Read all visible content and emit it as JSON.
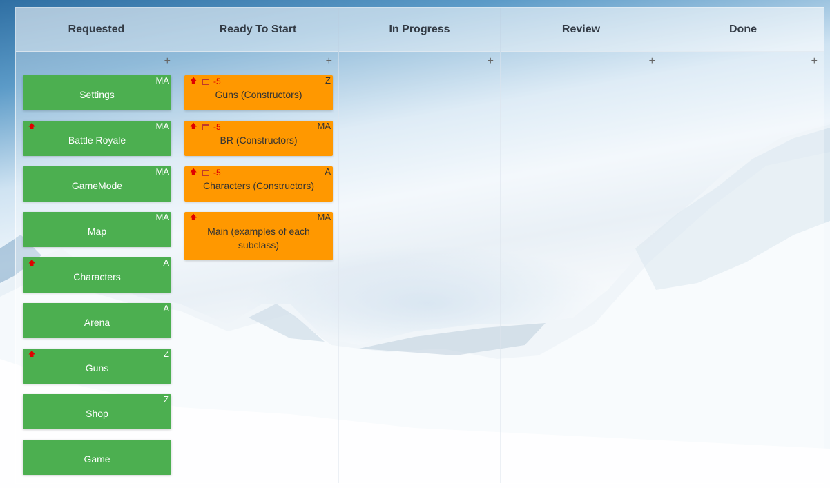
{
  "columns": [
    {
      "title": "Requested",
      "add_label": "+",
      "cards": [
        {
          "title": "Settings",
          "assignee": "MA",
          "priority": false
        },
        {
          "title": "Battle Royale",
          "assignee": "MA",
          "priority": true
        },
        {
          "title": "GameMode",
          "assignee": "MA",
          "priority": false
        },
        {
          "title": "Map",
          "assignee": "MA",
          "priority": false
        },
        {
          "title": "Characters",
          "assignee": "A",
          "priority": true
        },
        {
          "title": "Arena",
          "assignee": "A",
          "priority": false
        },
        {
          "title": "Guns",
          "assignee": "Z",
          "priority": true
        },
        {
          "title": "Shop",
          "assignee": "Z",
          "priority": false
        },
        {
          "title": "Game",
          "assignee": "",
          "priority": false
        }
      ]
    },
    {
      "title": "Ready To Start",
      "add_label": "+",
      "cards": [
        {
          "title": "Guns (Constructors)",
          "assignee": "Z",
          "priority": true,
          "due": "-5"
        },
        {
          "title": "BR (Constructors)",
          "assignee": "MA",
          "priority": true,
          "due": "-5"
        },
        {
          "title": "Characters (Constructors)",
          "assignee": "A",
          "priority": true,
          "due": "-5"
        },
        {
          "title": "Main (examples of each subclass)",
          "assignee": "MA",
          "priority": true,
          "due": ""
        }
      ]
    },
    {
      "title": "In Progress",
      "add_label": "+",
      "cards": []
    },
    {
      "title": "Review",
      "add_label": "+",
      "cards": []
    },
    {
      "title": "Done",
      "add_label": "+",
      "cards": []
    }
  ],
  "icons": {
    "priority": "arrow-up-icon",
    "due": "calendar-icon",
    "add": "plus-icon"
  },
  "colors": {
    "requested_card": "#4caf50",
    "ready_card": "#ff9800",
    "priority": "#e00000"
  }
}
